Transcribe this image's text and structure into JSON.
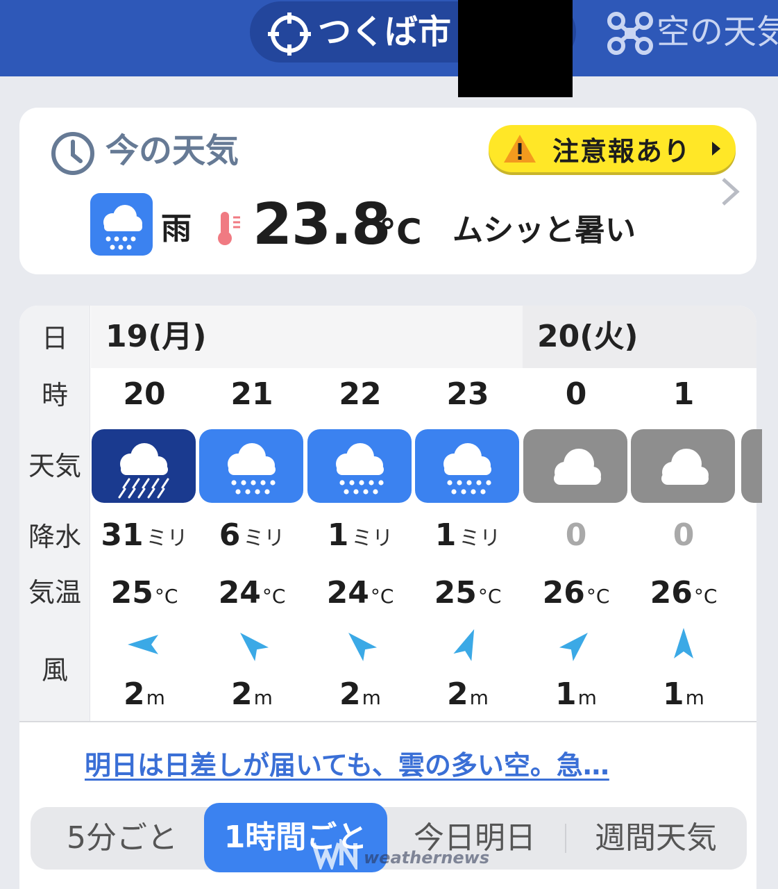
{
  "header": {
    "location": "つくば市",
    "sky_label": "空の天気",
    "location_icon": "target-icon",
    "sky_icon": "drone-icon"
  },
  "now": {
    "title": "今の天気",
    "advisory": "注意報あり",
    "condition": "雨",
    "temperature": "23.8",
    "temp_unit": "°C",
    "feeling": "ムシッと暑い",
    "icon": "rain-icon"
  },
  "forecast": {
    "row_labels": {
      "day": "日",
      "hour": "時",
      "weather": "天気",
      "precip": "降水",
      "temp": "気温",
      "wind": "風"
    },
    "days": [
      "19(月)",
      "20(火)"
    ],
    "hours": [
      {
        "hour": "20",
        "weather": "heavy-rain-icon",
        "precip": "31",
        "precip_unit": "ミリ",
        "temp": "25",
        "temp_unit": "°C",
        "wind_dir": "W",
        "wind": "2",
        "wind_unit": "m"
      },
      {
        "hour": "21",
        "weather": "rain-icon",
        "precip": "6",
        "precip_unit": "ミリ",
        "temp": "24",
        "temp_unit": "°C",
        "wind_dir": "NW",
        "wind": "2",
        "wind_unit": "m"
      },
      {
        "hour": "22",
        "weather": "rain-icon",
        "precip": "1",
        "precip_unit": "ミリ",
        "temp": "24",
        "temp_unit": "°C",
        "wind_dir": "NW",
        "wind": "2",
        "wind_unit": "m"
      },
      {
        "hour": "23",
        "weather": "rain-icon",
        "precip": "1",
        "precip_unit": "ミリ",
        "temp": "25",
        "temp_unit": "°C",
        "wind_dir": "NNE",
        "wind": "2",
        "wind_unit": "m"
      },
      {
        "hour": "0",
        "weather": "cloudy-icon",
        "precip": "0",
        "precip_unit": "",
        "temp": "26",
        "temp_unit": "°C",
        "wind_dir": "NE",
        "wind": "1",
        "wind_unit": "m"
      },
      {
        "hour": "1",
        "weather": "cloudy-icon",
        "precip": "0",
        "precip_unit": "",
        "temp": "26",
        "temp_unit": "°C",
        "wind_dir": "N",
        "wind": "1",
        "wind_unit": "m"
      }
    ],
    "commentary": "明日は日差しが届いても、雲の多い空。急…"
  },
  "tabs": [
    {
      "label": "5分ごと",
      "active": false
    },
    {
      "label": "1時間ごと",
      "active": true
    },
    {
      "label": "今日明日",
      "active": false
    },
    {
      "label": "週間天気",
      "active": false
    }
  ],
  "watermark": "weathernews",
  "colors": {
    "header_bg": "#2e58b8",
    "rain_blue": "#3b82f0",
    "heavy_rain_navy": "#1a3a8f",
    "cloudy_gray": "#8e8e8e",
    "advisory_yellow": "#ffe727",
    "wind_arrow": "#3ba9e6",
    "link_blue": "#3a6fd6"
  }
}
